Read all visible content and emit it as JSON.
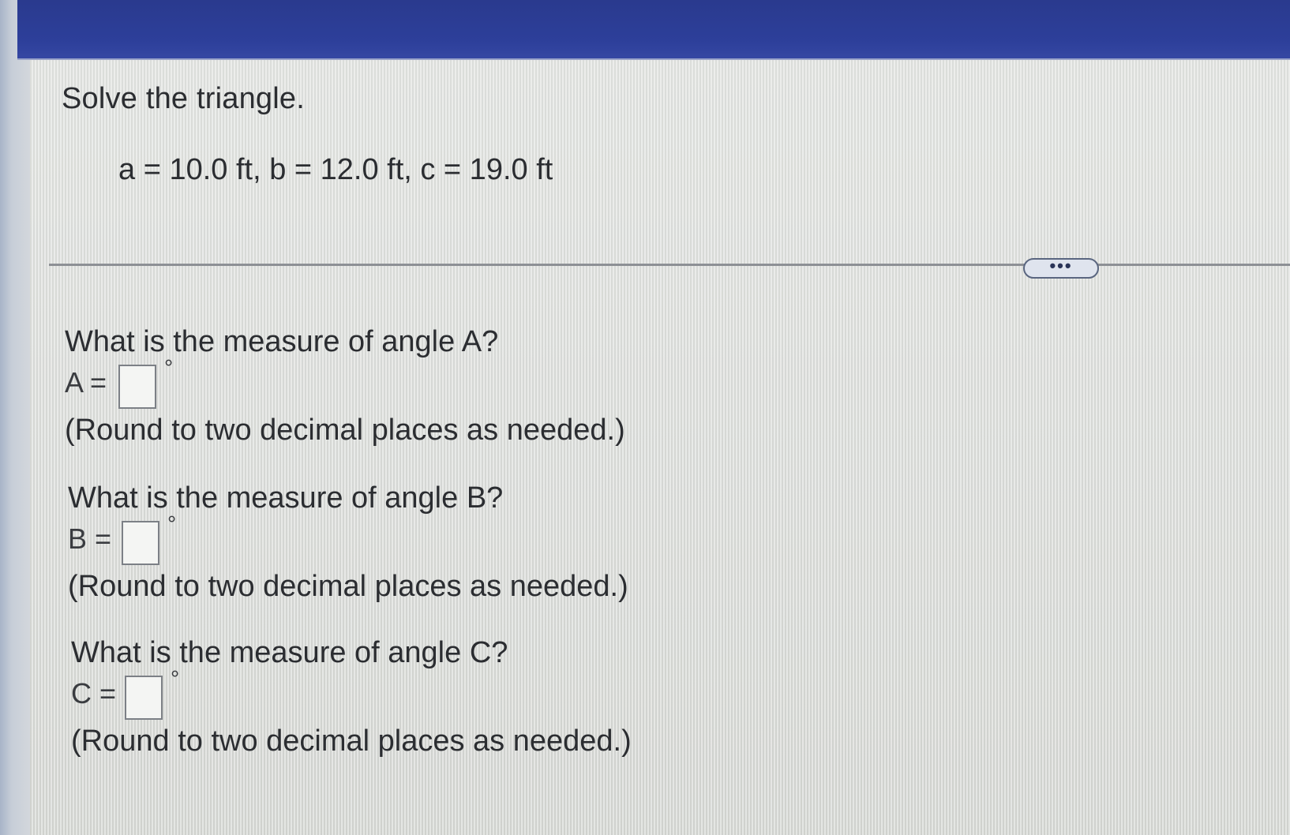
{
  "problem": {
    "title": "Solve the triangle.",
    "given": "a = 10.0 ft, b = 12.0 ft, c = 19.0 ft"
  },
  "more_button": {
    "label": "•••"
  },
  "questions": [
    {
      "prompt": "What is the measure of angle A?",
      "label": "A =",
      "value": "",
      "unit": "°",
      "hint": "(Round to two decimal places as needed.)"
    },
    {
      "prompt": "What is the measure of angle B?",
      "label": "B =",
      "value": "",
      "unit": "°",
      "hint": "(Round to two decimal places as needed.)"
    },
    {
      "prompt": "What is the measure of angle C?",
      "label": "C =",
      "value": "",
      "unit": "°",
      "hint": "(Round to two decimal places as needed.)"
    }
  ],
  "colors": {
    "header_bar": "#2d3f9a",
    "text": "#2b2d31",
    "background": "#dcdedb"
  }
}
